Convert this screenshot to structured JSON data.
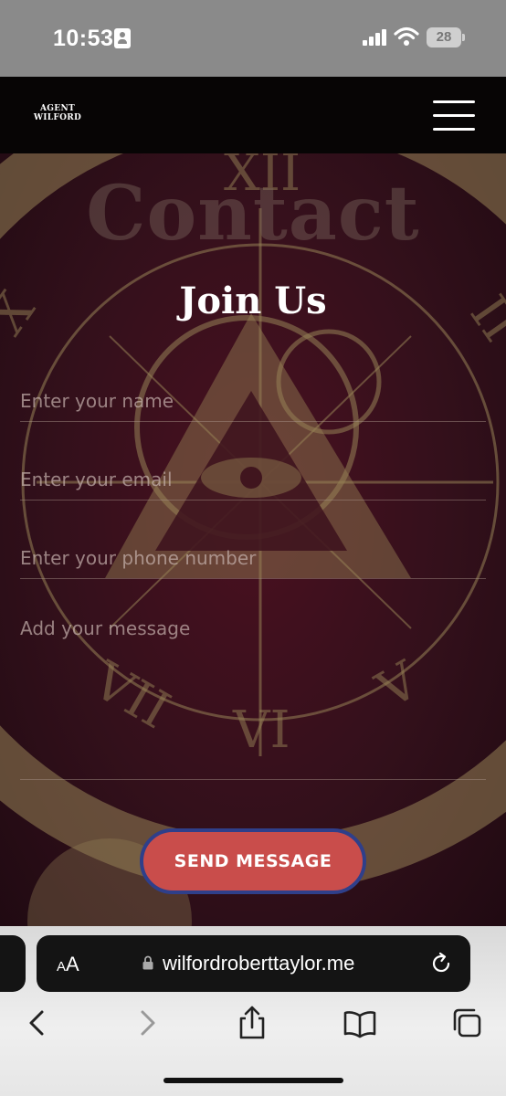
{
  "status_bar": {
    "time": "10:53",
    "battery": "28",
    "icons": [
      "id-card-icon",
      "cellular-signal-icon",
      "wifi-icon",
      "battery-icon"
    ]
  },
  "header": {
    "logo_line1": "AGENT",
    "logo_line2": "WILFORD",
    "menu_icon": "hamburger-menu-icon"
  },
  "page": {
    "background_heading": "Contact",
    "form_title": "Join Us"
  },
  "form": {
    "name_placeholder": "Enter your name",
    "email_placeholder": "Enter your email",
    "phone_placeholder": "Enter your phone number",
    "message_placeholder": "Add your message",
    "submit_label": "SEND MESSAGE"
  },
  "browser": {
    "text_size_label_small": "A",
    "text_size_label_large": "A",
    "url": "wilfordroberttaylor.me",
    "toolbar_icons": [
      "back-icon",
      "forward-icon",
      "share-icon",
      "bookmarks-icon",
      "tabs-icon"
    ]
  },
  "colors": {
    "status_bar_bg": "#8a8a8a",
    "header_bg": "#070505",
    "hero_bg": "#33101b",
    "button_bg": "#c94d4b",
    "button_border": "#2f3f8a",
    "address_bar_bg": "#141414"
  }
}
